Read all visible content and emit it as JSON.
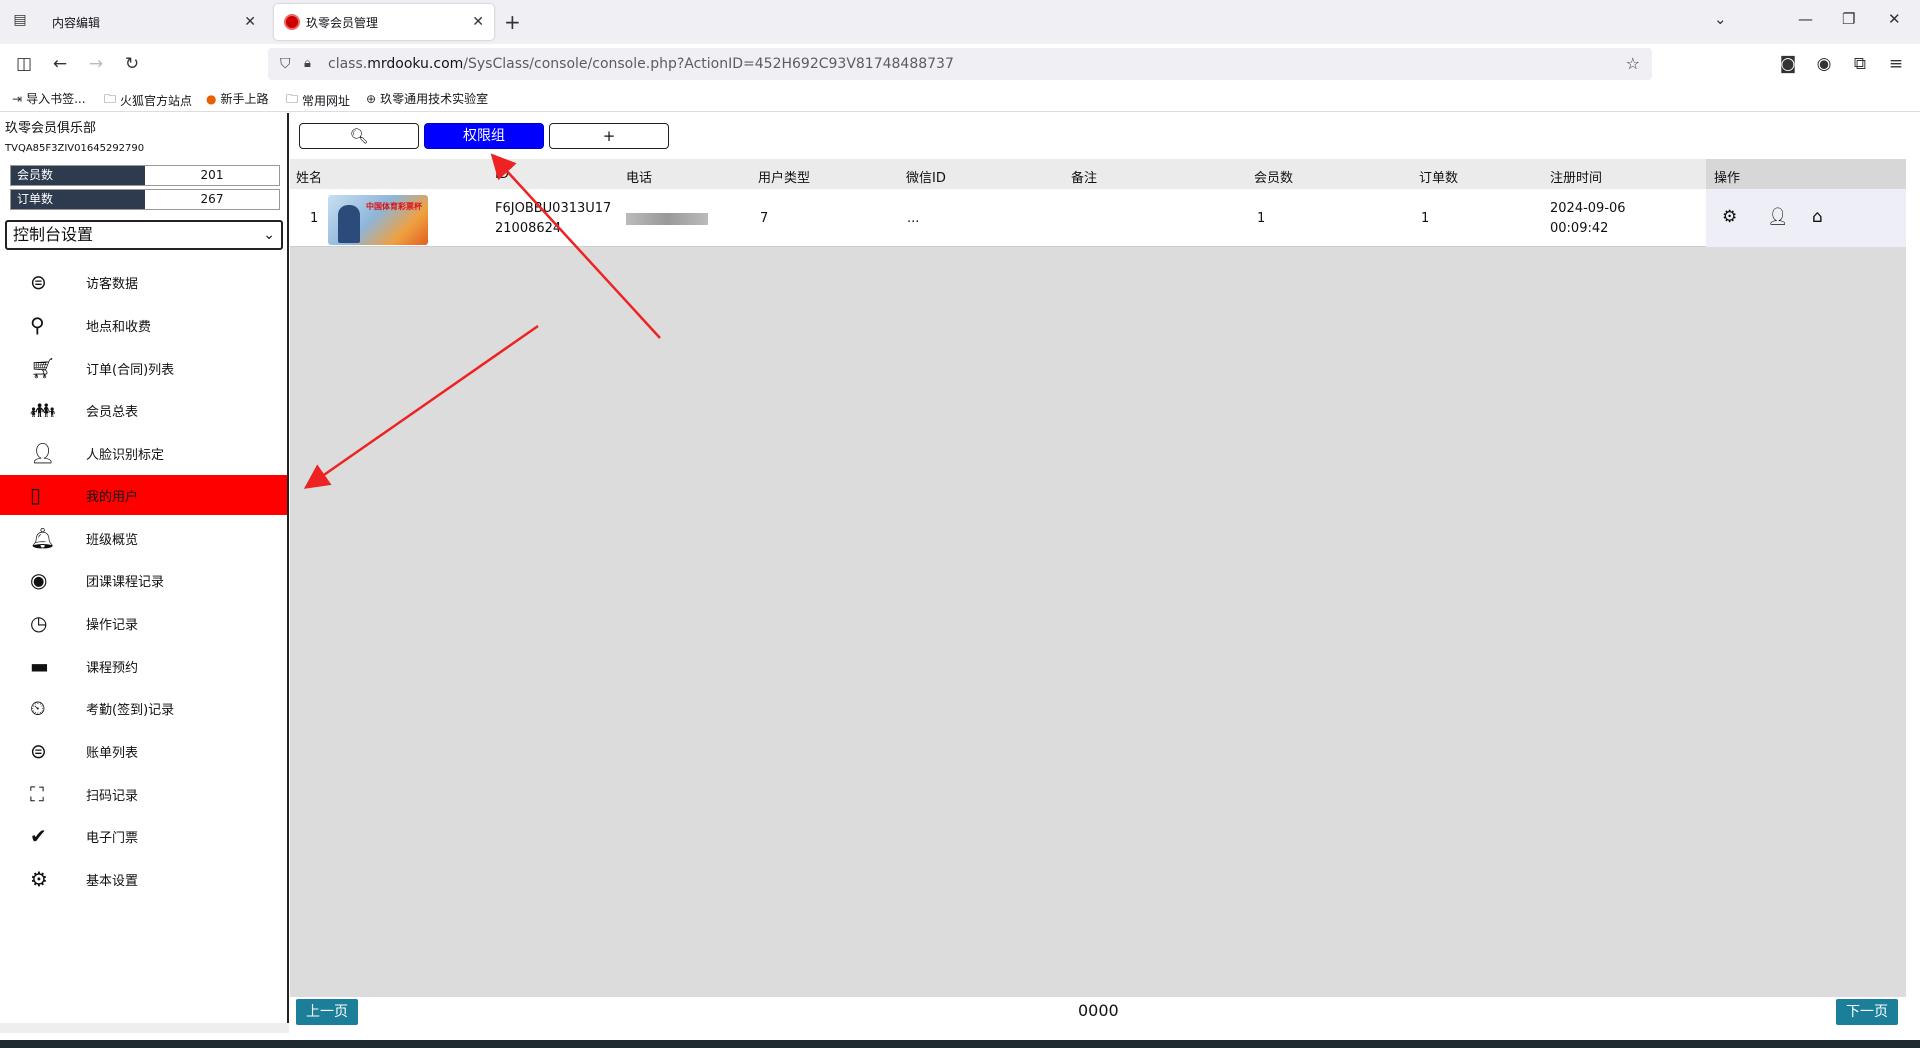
{
  "browser": {
    "tabs": [
      {
        "label": "内容编辑"
      },
      {
        "label": "玖零会员管理"
      }
    ],
    "url_prefix": "class.",
    "url_domain": "mrdooku.com",
    "url_path": "/SysClass/console/console.php?ActionID=452H692C93V81748488737",
    "bookmarks": [
      "导入书签...",
      "火狐官方站点",
      "新手上路",
      "常用网址",
      "玖零通用技术实验室"
    ]
  },
  "sidebar": {
    "club_name": "玖零会员俱乐部",
    "club_id": "TVQA85F3ZIV01645292790",
    "stats": [
      {
        "label": "会员数",
        "value": "201"
      },
      {
        "label": "订单数",
        "value": "267"
      }
    ],
    "console_select": "控制台设置",
    "items": [
      {
        "label": "访客数据",
        "icon": "dollar-circle-icon"
      },
      {
        "label": "地点和收费",
        "icon": "map-pin-icon"
      },
      {
        "label": "订单(合同)列表",
        "icon": "cart-icon"
      },
      {
        "label": "会员总表",
        "icon": "people-icon"
      },
      {
        "label": "人脸识别标定",
        "icon": "person-icon"
      },
      {
        "label": "我的用户",
        "icon": "tablet-icon"
      },
      {
        "label": "班级概览",
        "icon": "bell-icon"
      },
      {
        "label": "团课课程记录",
        "icon": "eye-icon"
      },
      {
        "label": "操作记录",
        "icon": "clock-icon"
      },
      {
        "label": "课程预约",
        "icon": "calendar-icon"
      },
      {
        "label": "考勤(签到)记录",
        "icon": "clock-pin-icon"
      },
      {
        "label": "账单列表",
        "icon": "dollar-circle-icon"
      },
      {
        "label": "扫码记录",
        "icon": "scan-icon"
      },
      {
        "label": "电子门票",
        "icon": "check-circle-icon"
      },
      {
        "label": "基本设置",
        "icon": "gear-icon"
      }
    ],
    "active_item": "我的用户",
    "active_color": "#ff0000"
  },
  "toolbar": {
    "search_icon": "search-icon",
    "permission_label": "权限组",
    "add_icon": "plus-icon"
  },
  "table": {
    "headers": [
      "姓名",
      "ID",
      "电话",
      "用户类型",
      "微信ID",
      "备注",
      "会员数",
      "订单数",
      "注册时间",
      "操作"
    ],
    "rows": [
      {
        "index": "1",
        "id_line1": "F6JOBBU0313U17",
        "id_line2": "21008624",
        "phone": "",
        "user_type": "7",
        "wechat_id": "...",
        "note": "",
        "members": "1",
        "orders": "1",
        "reg_date": "2024-09-06",
        "reg_time": "00:09:42",
        "thumb_text": "中国体育彩票杯"
      }
    ]
  },
  "pagination": {
    "prev": "上一页",
    "info": "0000",
    "next": "下一页"
  }
}
